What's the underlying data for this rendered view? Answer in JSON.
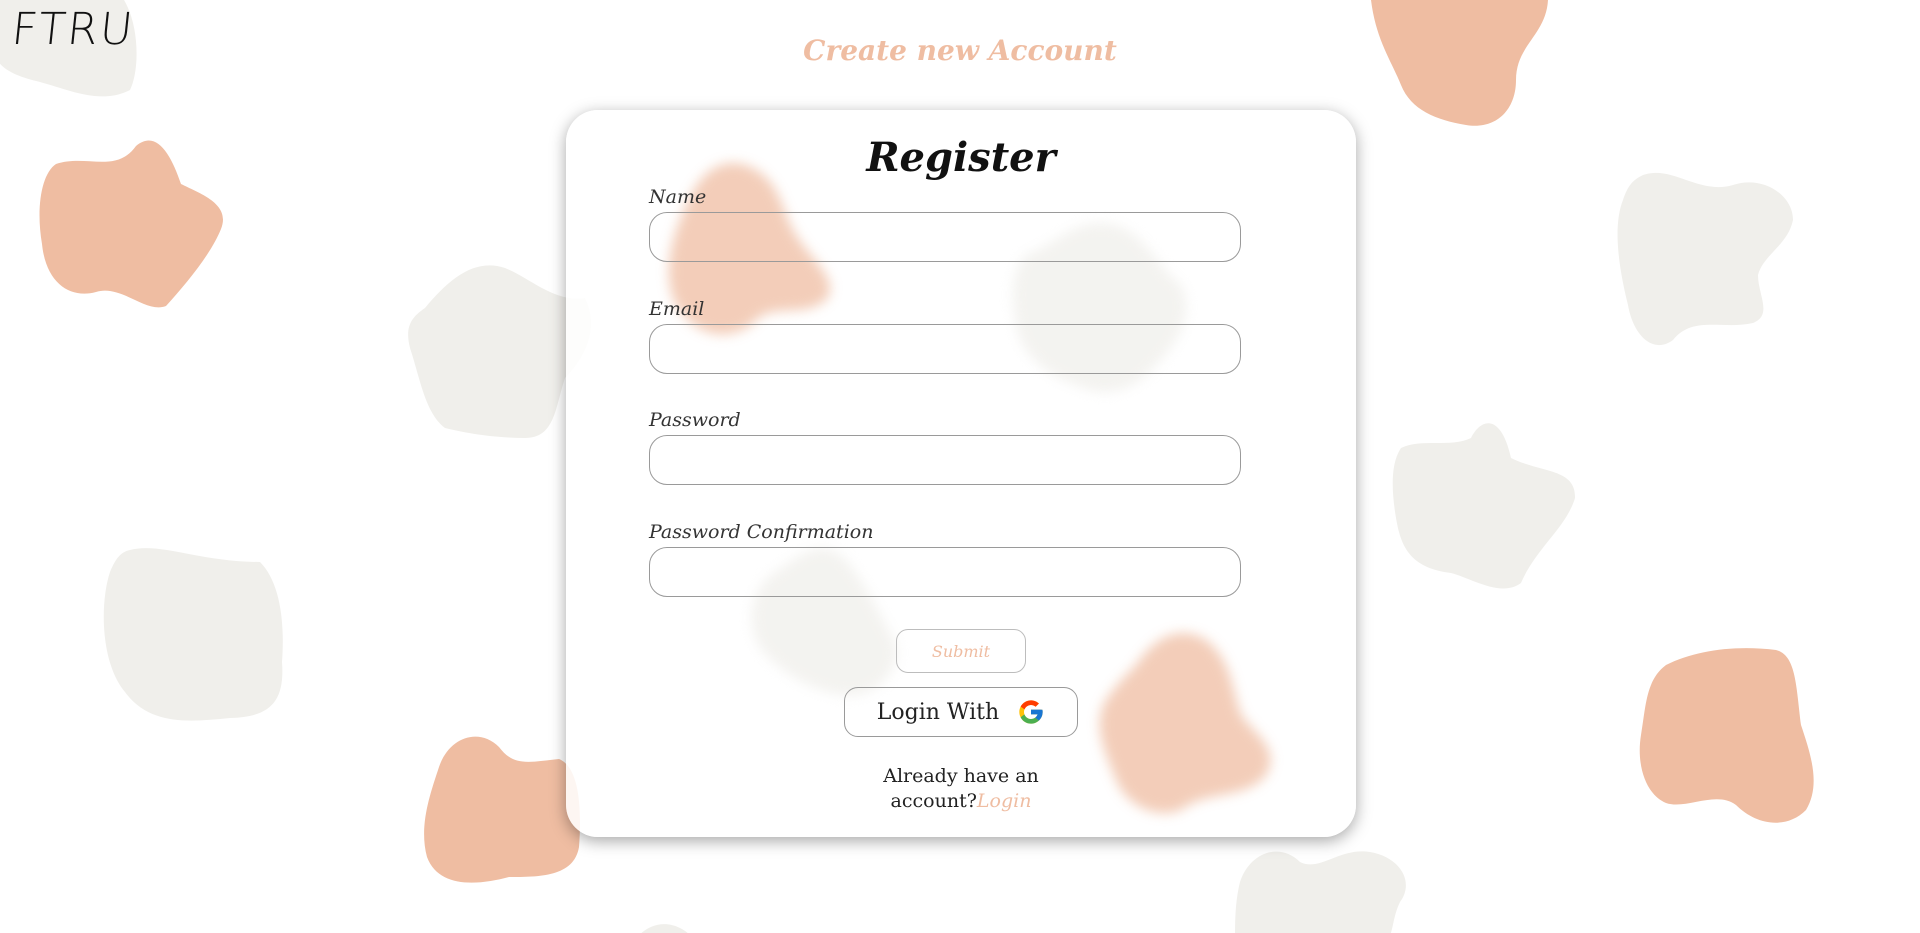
{
  "app": {
    "logo_text": "FTRU",
    "page_title": "Create new Account"
  },
  "form": {
    "heading": "Register",
    "fields": [
      {
        "label": "Name",
        "value": "",
        "placeholder": ""
      },
      {
        "label": "Email",
        "value": "",
        "placeholder": ""
      },
      {
        "label": "Password",
        "value": "",
        "placeholder": ""
      },
      {
        "label": "Password Confirmation",
        "value": "",
        "placeholder": ""
      }
    ],
    "submit_label": "Submit",
    "google_button_label": "Login With",
    "google_icon": "google-g-icon",
    "footer_text": "Already have an account?",
    "login_link_label": "Login"
  },
  "colors": {
    "accent": "#efbda2",
    "blob_peach": "#efbda2",
    "blob_beige": "#f0efeb"
  }
}
